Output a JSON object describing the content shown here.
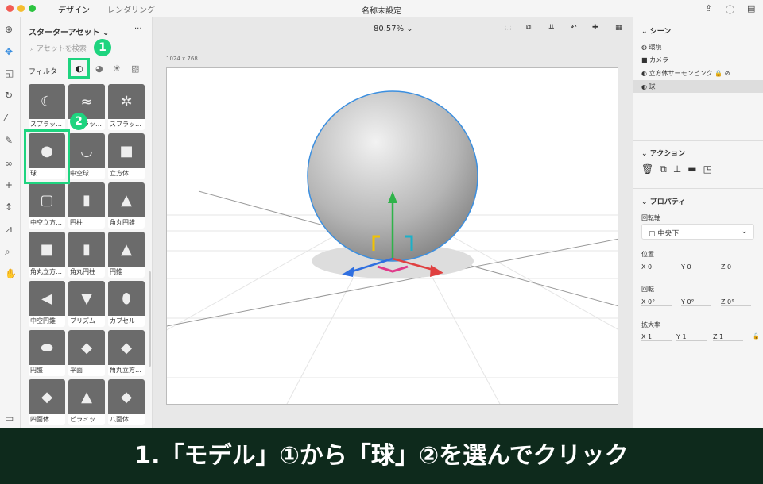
{
  "topbar": {
    "tabs": [
      "デザイン",
      "レンダリング"
    ],
    "title": "名称未設定"
  },
  "left_panel": {
    "title": "スターターアセット ⌄",
    "more": "···",
    "search_placeholder": "アセットを検索",
    "filter_label": "フィルター",
    "assets": [
      {
        "label": "スプラッ…",
        "glyph": "☾"
      },
      {
        "label": "スプラッ…",
        "glyph": "≈"
      },
      {
        "label": "スプラッ…",
        "glyph": "✲"
      },
      {
        "label": "球",
        "glyph": "●"
      },
      {
        "label": "中空球",
        "glyph": "◡"
      },
      {
        "label": "立方体",
        "glyph": "■"
      },
      {
        "label": "中空立方…",
        "glyph": "▢"
      },
      {
        "label": "円柱",
        "glyph": "▮"
      },
      {
        "label": "角丸円錐",
        "glyph": "▲"
      },
      {
        "label": "角丸立方…",
        "glyph": "■"
      },
      {
        "label": "角丸円柱",
        "glyph": "▮"
      },
      {
        "label": "円錐",
        "glyph": "▲"
      },
      {
        "label": "中空円錐",
        "glyph": "◀"
      },
      {
        "label": "プリズム",
        "glyph": "▼"
      },
      {
        "label": "カプセル",
        "glyph": "⬮"
      },
      {
        "label": "円盤",
        "glyph": "⬬"
      },
      {
        "label": "平面",
        "glyph": "◆"
      },
      {
        "label": "角丸立方…",
        "glyph": "◆"
      },
      {
        "label": "四面体",
        "glyph": "◆"
      },
      {
        "label": "ピラミッ…",
        "glyph": "▲"
      },
      {
        "label": "八面体",
        "glyph": "◆"
      }
    ]
  },
  "badges": [
    "1",
    "2"
  ],
  "canvas": {
    "zoom": "80.57% ⌄",
    "size": "1024 x 768"
  },
  "right_panel": {
    "scene_title": "シーン",
    "scene_items": [
      "環境",
      "カメラ",
      "立方体サーモンピンク",
      "球"
    ],
    "actions_title": "アクション",
    "properties_title": "プロパティ",
    "pivot_label": "回転軸",
    "pivot_value": "中央下",
    "position_label": "位置",
    "position": {
      "x": "0",
      "y": "0",
      "z": "0"
    },
    "rotation_label": "回転",
    "rotation": {
      "x": "0°",
      "y": "0°",
      "z": "0°"
    },
    "scale_label": "拡大率",
    "scale": {
      "x": "1",
      "y": "1",
      "z": "1"
    }
  },
  "caption": "1.「モデル」①から「球」②を選んでクリック",
  "colors": {
    "highlight": "#1ed47f",
    "caption_bg": "#0e2a1c",
    "selection": "#3b8fe0"
  }
}
